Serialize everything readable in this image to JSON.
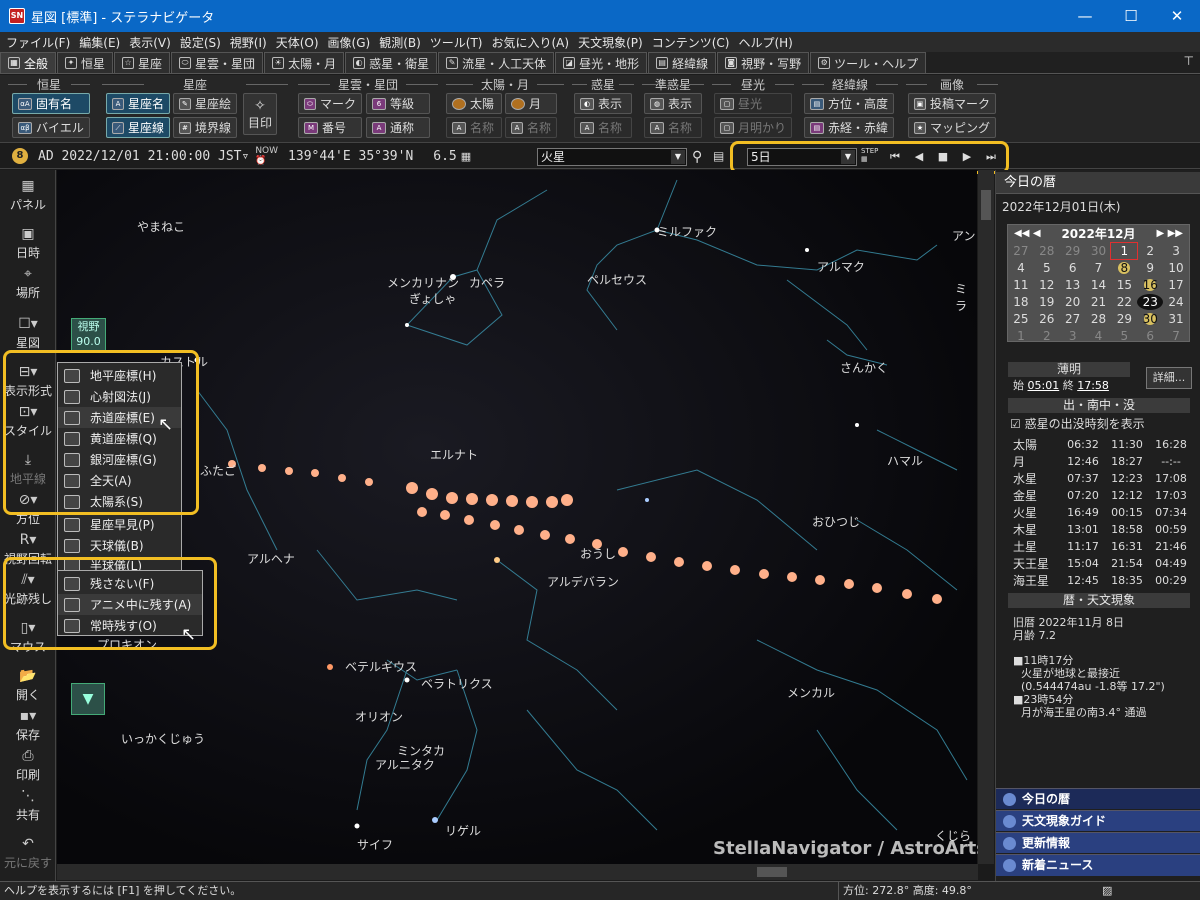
{
  "window": {
    "title": "星図 [標準] - ステラナビゲータ",
    "app_icon": "SN",
    "controls": {
      "minimize": "—",
      "maximize": "☐",
      "close": "✕"
    }
  },
  "menu": [
    "ファイル(F)",
    "編集(E)",
    "表示(V)",
    "設定(S)",
    "視野(I)",
    "天体(O)",
    "画像(G)",
    "観測(B)",
    "ツール(T)",
    "お気に入り(A)",
    "天文現象(P)",
    "コンテンツ(C)",
    "ヘルプ(H)"
  ],
  "tabs": [
    {
      "label": "全般",
      "icon": "▦",
      "active": true
    },
    {
      "label": "恒星",
      "icon": "✦"
    },
    {
      "label": "星座",
      "icon": "☆"
    },
    {
      "label": "星雲・星団",
      "icon": "⬭"
    },
    {
      "label": "太陽・月",
      "icon": "☀"
    },
    {
      "label": "惑星・衛星",
      "icon": "◐"
    },
    {
      "label": "流星・人工天体",
      "icon": "✎"
    },
    {
      "label": "昼光・地形",
      "icon": "◪"
    },
    {
      "label": "経緯線",
      "icon": "▤"
    },
    {
      "label": "視野・写野",
      "icon": "◙"
    },
    {
      "label": "ツール・ヘルプ",
      "icon": "⚙"
    }
  ],
  "ribbon": {
    "stars": {
      "title": "恒星",
      "btn1": "固有名",
      "btn2": "バイエル"
    },
    "const": {
      "title": "星座",
      "btn1": "星座名",
      "btn2": "星座絵",
      "btn3": "星座線",
      "btn4": "境界線",
      "mark": "目印"
    },
    "nebula": {
      "title": "星雲・星団",
      "btn1": "マーク",
      "btn2": "等級",
      "btn3": "番号",
      "btn4": "通称"
    },
    "sunmoon": {
      "title": "太陽・月",
      "btn1": "太陽",
      "btn2": "月",
      "btn3": "名称",
      "btn4": "名称"
    },
    "planet": {
      "title": "惑星",
      "btn1": "表示",
      "btn2": "名称"
    },
    "minor": {
      "title": "準惑星",
      "btn1": "表示",
      "btn2": "名称"
    },
    "daylight": {
      "title": "昼光",
      "btn1": "昼光",
      "btn2": "月明かり"
    },
    "grid": {
      "title": "経緯線",
      "btn1": "方位・高度",
      "btn2": "赤経・赤緯"
    },
    "image": {
      "title": "画像",
      "btn1": "投稿マーク",
      "btn2": "マッピング"
    }
  },
  "infobar": {
    "icon": "8",
    "datetime": "AD 2022/12/01 21:00:00 JST▿",
    "coords": "139°44'E 35°39'N",
    "mag": "6.5",
    "target": "火星",
    "step": "5日",
    "step_label": "STEP"
  },
  "leftbar": {
    "panel": "パネル",
    "datetime": "日時",
    "place": "場所",
    "chart": "星図",
    "display": "表示形式",
    "style": "スタイル",
    "horizon": "地平線",
    "direction": "方位",
    "rotate": "視野回転",
    "trail": "光跡残し",
    "mouse": "マウス",
    "open": "開く",
    "save": "保存",
    "print": "印刷",
    "share": "共有",
    "undo": "元に戻す"
  },
  "fov": {
    "label": "視野",
    "value": "90.0"
  },
  "popup_display": [
    "地平座標(H)",
    "心射図法(J)",
    "赤道座標(E)",
    "黄道座標(Q)",
    "銀河座標(G)",
    "全天(A)",
    "太陽系(S)",
    "星座早見(P)",
    "天球儀(B)",
    "半球儀(L)"
  ],
  "popup_trail": [
    "残さない(F)",
    "アニメ中に残す(A)",
    "常時残す(O)"
  ],
  "sky_labels": {
    "yamaneko": "やまねこ",
    "menkalinan": "メンカリナン",
    "gyosha": "ぎょしゃ",
    "capella": "カペラ",
    "perseus": "ペルセウス",
    "mirfak": "ミルファク",
    "almach": "アルマク",
    "anndo": "アン",
    "mira": "ミラ",
    "sankaku": "さんかく",
    "castor": "カストル",
    "futago": "ふたご",
    "elnath": "エルナト",
    "hamal": "ハマル",
    "ohitsuji": "おひつじ",
    "oushi": "おうし",
    "alhena": "アルヘナ",
    "aldebaran": "アルデバラン",
    "procyon": "プロキオン",
    "betelgeuse": "ベテルギウス",
    "bellatrix": "ベラトリクス",
    "orion": "オリオン",
    "mintaka": "ミンタカ",
    "alnitak": "アルニタク",
    "menkar": "メンカル",
    "ikkakujuu": "いっかくじゅう",
    "saiph": "サイフ",
    "rigel": "リゲル",
    "kujira": "くじら"
  },
  "watermark": "StellaNavigator / AstroArts",
  "right": {
    "header": "今日の暦",
    "date": "2022年12月01日(木)",
    "cal_month": "2022年12月",
    "cal_days": [
      "27",
      "28",
      "29",
      "30",
      "1",
      "2",
      "3",
      "4",
      "5",
      "6",
      "7",
      "8",
      "9",
      "10",
      "11",
      "12",
      "13",
      "14",
      "15",
      "16",
      "17",
      "18",
      "19",
      "20",
      "21",
      "22",
      "23",
      "24",
      "25",
      "26",
      "27",
      "28",
      "29",
      "30",
      "31",
      "1",
      "2",
      "3",
      "4",
      "5",
      "6",
      "7"
    ],
    "twilight": "薄明",
    "tw_start_label": "始",
    "tw_start": "05:01",
    "tw_end_label": "終",
    "tw_end": "17:58",
    "detail": "詳細...",
    "rise_header": "出・南中・没",
    "rise_check": "惑星の出没時刻を表示",
    "bodies": [
      [
        "太陽",
        "06:32",
        "11:30",
        "16:28"
      ],
      [
        "月",
        "12:46",
        "18:27",
        "--:--"
      ],
      [
        "水星",
        "07:37",
        "12:23",
        "17:08"
      ],
      [
        "金星",
        "07:20",
        "12:12",
        "17:03"
      ],
      [
        "火星",
        "16:49",
        "00:15",
        "07:34"
      ],
      [
        "木星",
        "13:01",
        "18:58",
        "00:59"
      ],
      [
        "土星",
        "11:17",
        "16:31",
        "21:46"
      ],
      [
        "天王星",
        "15:04",
        "21:54",
        "04:49"
      ],
      [
        "海王星",
        "12:45",
        "18:35",
        "00:29"
      ]
    ],
    "events_header": "暦・天文現象",
    "lunar": "旧暦  2022年11月 8日",
    "moonage": "月齢  7.2",
    "ev1": "■11時17分",
    "ev1b": "火星が地球と最接近",
    "ev1c": "(0.544474au -1.8等 17.2\")",
    "ev2": "■23時54分",
    "ev2b": "月が海王星の南3.4°  通過",
    "bottom": [
      "今日の暦",
      "天文現象ガイド",
      "更新情報",
      "新着ニュース"
    ]
  },
  "status": {
    "help": "ヘルプを表示するには [F1] を押してください。",
    "azimuth": "方位: 272.8°  高度:  49.8°"
  }
}
